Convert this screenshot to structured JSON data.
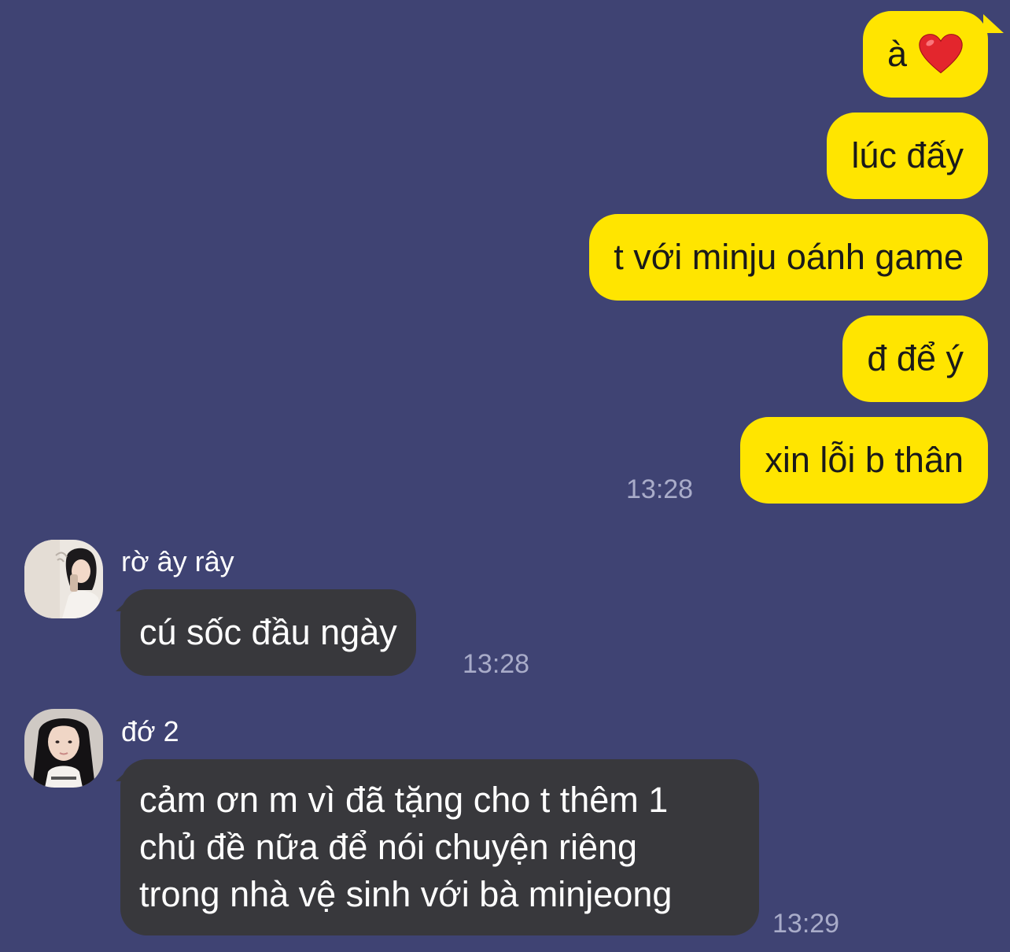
{
  "outgoing": {
    "messages": [
      {
        "text": "à",
        "emoji": "heart-emoji"
      },
      {
        "text": "lúc đấy"
      },
      {
        "text": "t với minju oánh game"
      },
      {
        "text": "đ để ý"
      },
      {
        "text": "xin lỗi b thân"
      }
    ],
    "time": "13:28"
  },
  "incoming": [
    {
      "sender": "rờ ây rây",
      "avatar": "profile-photo",
      "lines": [
        "cú sốc đầu ngày"
      ],
      "time": "13:28"
    },
    {
      "sender": "đớ 2",
      "avatar": "profile-photo",
      "lines": [
        "cảm ơn m vì đã tặng cho t thêm 1",
        "chủ đề nữa để nói chuyện riêng",
        "trong nhà vệ sinh với bà minjeong"
      ],
      "time": "13:29"
    }
  ],
  "colors": {
    "background": "#3f4373",
    "outgoing_bubble": "#ffe500",
    "incoming_bubble": "#38383c",
    "timestamp": "#a9acc9"
  }
}
